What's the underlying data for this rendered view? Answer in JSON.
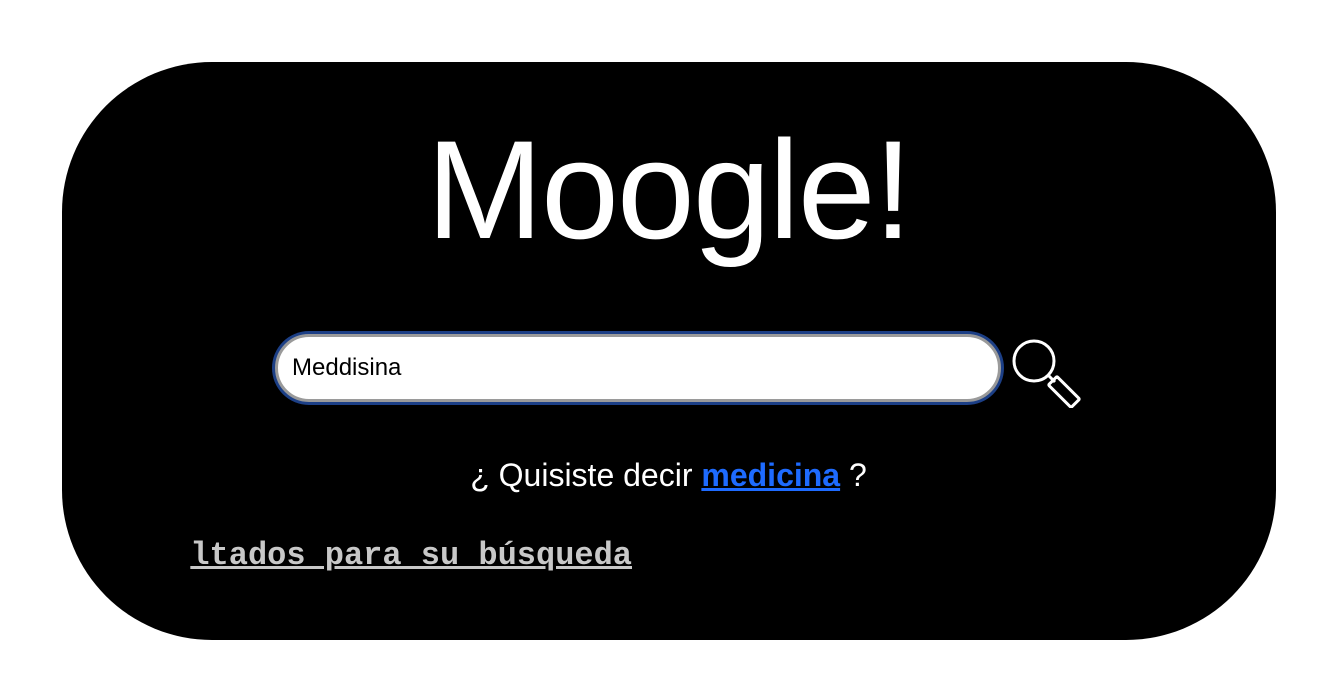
{
  "logo": {
    "text": "Moogle!"
  },
  "search": {
    "value": "Meddisina",
    "icon": "magnifier-icon",
    "box_border_color": "#1c3f86"
  },
  "suggestion": {
    "prefix": "¿ Quisiste decir",
    "link": "medicina",
    "suffix": "?",
    "link_color": "#1e6bff"
  },
  "results": {
    "link_text": "ltados para su búsqueda",
    "color": "#c8c8c8"
  },
  "colors": {
    "panel_bg": "#000000",
    "page_bg": "#ffffff",
    "text": "#ffffff"
  }
}
